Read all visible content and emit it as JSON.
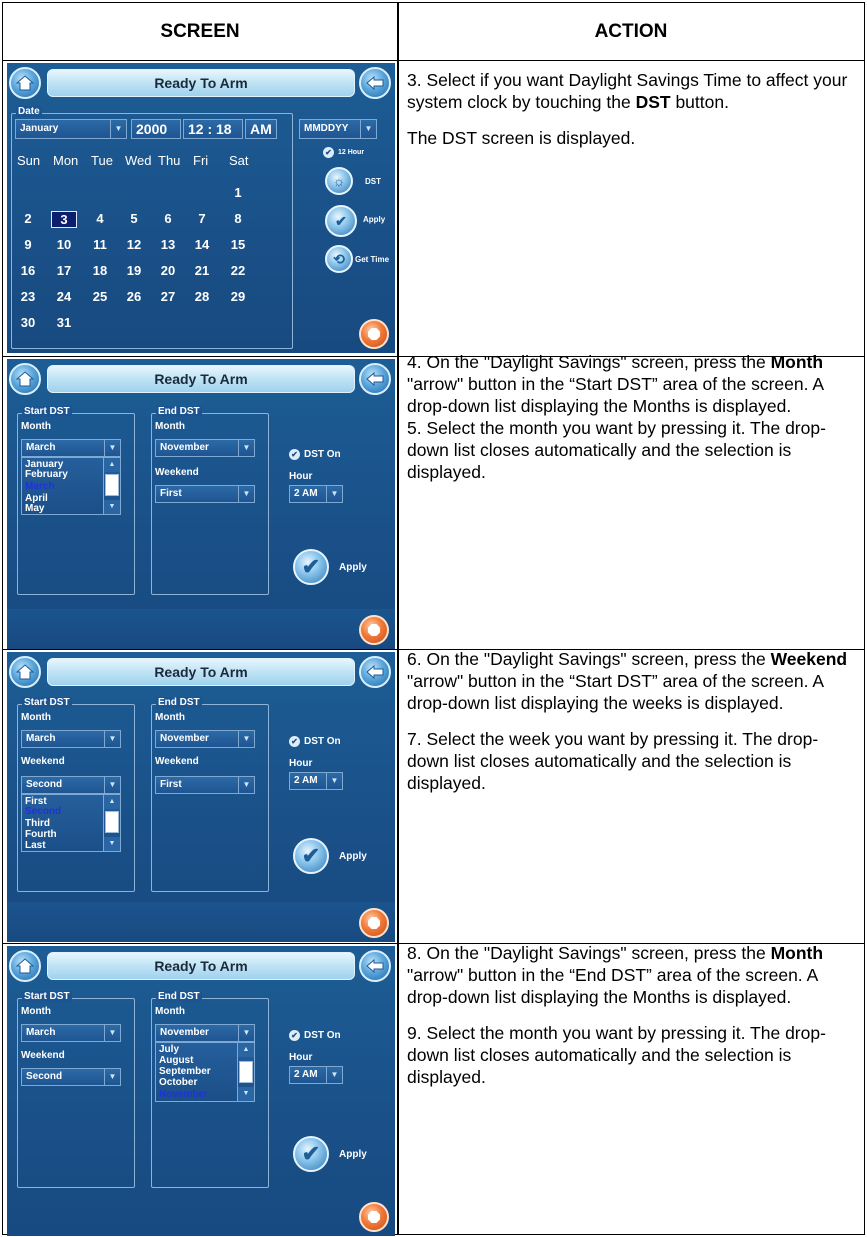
{
  "header": {
    "screen": "SCREEN",
    "action": "ACTION"
  },
  "common": {
    "title": "Ready To Arm",
    "start_dst": "Start DST",
    "end_dst": "End DST",
    "month": "Month",
    "weekend": "Weekend",
    "dst_on": "DST On",
    "hour": "Hour",
    "hour_value": "2 AM",
    "apply": "Apply"
  },
  "row1": {
    "date_label": "Date",
    "month_value": "January",
    "year": "2000",
    "time": "12 : 18",
    "ampm": "AM",
    "format": "MMDDYY",
    "twelve_hour": "12 Hour",
    "dst_btn": "DST",
    "apply_btn": "Apply",
    "get_time_btn": "Get Time",
    "weekdays": [
      "Sun",
      "Mon",
      "Tue",
      "Wed",
      "Thu",
      "Fri",
      "Sat"
    ],
    "weeks": [
      [
        "",
        "",
        "",
        "",
        "",
        "",
        "1"
      ],
      [
        "2",
        "3",
        "4",
        "5",
        "6",
        "7",
        "8"
      ],
      [
        "9",
        "10",
        "11",
        "12",
        "13",
        "14",
        "15"
      ],
      [
        "16",
        "17",
        "18",
        "19",
        "20",
        "21",
        "22"
      ],
      [
        "23",
        "24",
        "25",
        "26",
        "27",
        "28",
        "29"
      ],
      [
        "30",
        "31",
        "",
        "",
        "",
        "",
        ""
      ]
    ],
    "selected_day": "3",
    "action_p1_a": "3.  Select if you want Daylight Savings Time to affect your system clock by touching the ",
    "action_p1_b": "DST",
    "action_p1_c": " button.",
    "action_p2": "The DST screen is displayed."
  },
  "row2": {
    "start_month": "March",
    "end_month": "November",
    "end_weekend": "First",
    "list": [
      "January",
      "February",
      "March",
      "April",
      "May"
    ],
    "list_selected": "March",
    "action_p1_a": "4.  On the \"Daylight Savings\" screen, press the ",
    "action_p1_b": "Month",
    "action_p1_c": " \"arrow\" button in the “Start DST” area of the screen.  A drop-down list displaying the Months is displayed.",
    "action_p2": "5.  Select the month you want by pressing it.  The drop-down list closes automatically and the selection is displayed."
  },
  "row3": {
    "start_month": "March",
    "start_weekend": "Second",
    "end_month": "November",
    "end_weekend": "First",
    "list": [
      "First",
      "Second",
      "Third",
      "Fourth",
      "Last"
    ],
    "list_selected": "Second",
    "action_p1_a": "6.  On the \"Daylight Savings\" screen, press the ",
    "action_p1_b": "Weekend",
    "action_p1_c": " \"arrow\" button in the “Start DST” area of the screen.  A drop-down list displaying the weeks is displayed.",
    "action_p2": "7.  Select the week you want by pressing it.  The drop-down list closes automatically and the selection is displayed."
  },
  "row4": {
    "start_month": "March",
    "start_weekend": "Second",
    "end_month": "November",
    "list": [
      "July",
      "August",
      "September",
      "October",
      "November"
    ],
    "list_selected": "November",
    "action_p1_a": "8.  On the \"Daylight Savings\" screen, press the ",
    "action_p1_b": "Month",
    "action_p1_c": " \"arrow\" button in the “End DST” area of the screen.  A drop-down list displaying the Months is displayed.",
    "action_p2": "9.  Select the month you want by pressing it.  The drop-down list closes automatically and the selection is displayed."
  }
}
